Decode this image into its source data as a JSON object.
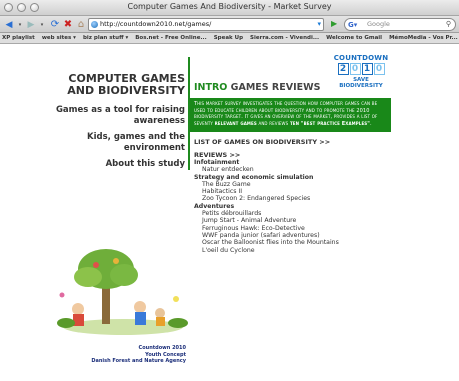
{
  "window": {
    "title": "Computer Games And Biodiversity - Market Survey"
  },
  "toolbar": {
    "url": "http://countdown2010.net/games/",
    "search_placeholder": "Google"
  },
  "bookmarks": [
    "XP playlist",
    "web sites ▾",
    "biz plan stuff ▾",
    "Bos.net - Free Online...",
    "Speak Up",
    "Sierra.com - Vivendi...",
    "Welcome to Gmail",
    "MémoMedia - Vos Pr..."
  ],
  "site": {
    "title_line1": "COMPUTER GAMES",
    "title_line2": "AND BIODIVERSITY",
    "nav": [
      {
        "label": "Games as a tool for raising awareness"
      },
      {
        "label": "Kids, games and the environment"
      },
      {
        "label": "About this study"
      }
    ],
    "section_accent": "INTRO",
    "section_rest": " GAMES REVIEWS",
    "logo_top": "COUNTDOWN",
    "logo_digits": [
      "2",
      "0",
      "1",
      "0"
    ],
    "logo_bottom": "SAVE BIODIVERSITY",
    "intro_part1": "This market survey investigates the question how computer games can be used to educate children about biodiversity and to promote the 2010 biodiversity target. It gives an overview of the market, provides a list of seventy ",
    "intro_bold1": "relevant games",
    "intro_part2": " and reviews ",
    "intro_bold2": "ten \"best practice Examples\"",
    "intro_part3": ".",
    "link_list": "LIST OF GAMES ON BIODIVERSITY >>",
    "link_reviews": "REVIEWS >>",
    "categories": [
      {
        "name": "Infotainment",
        "games": [
          "Natur entdecken"
        ]
      },
      {
        "name": "Strategy and economic simulation",
        "games": [
          "The Buzz Game",
          "Habitactics II",
          "Zoo Tycoon 2: Endangered Species"
        ]
      },
      {
        "name": "Adventures",
        "games": [
          "Petits débrouillards",
          "Jump Start - Animal Adventure",
          "Ferruginous Hawk: Eco-Detective",
          "WWF panda junior (safari adventures)",
          "Oscar the Balloonist flies into the Mountains",
          "L'oeil du Cyclone"
        ]
      }
    ],
    "credit": [
      "Countdown 2010",
      "Youth Concept",
      "Danish Forest and Nature Agency"
    ]
  },
  "colors": {
    "accent_green": "#198819",
    "logo_blue": "#1a6fc0"
  }
}
